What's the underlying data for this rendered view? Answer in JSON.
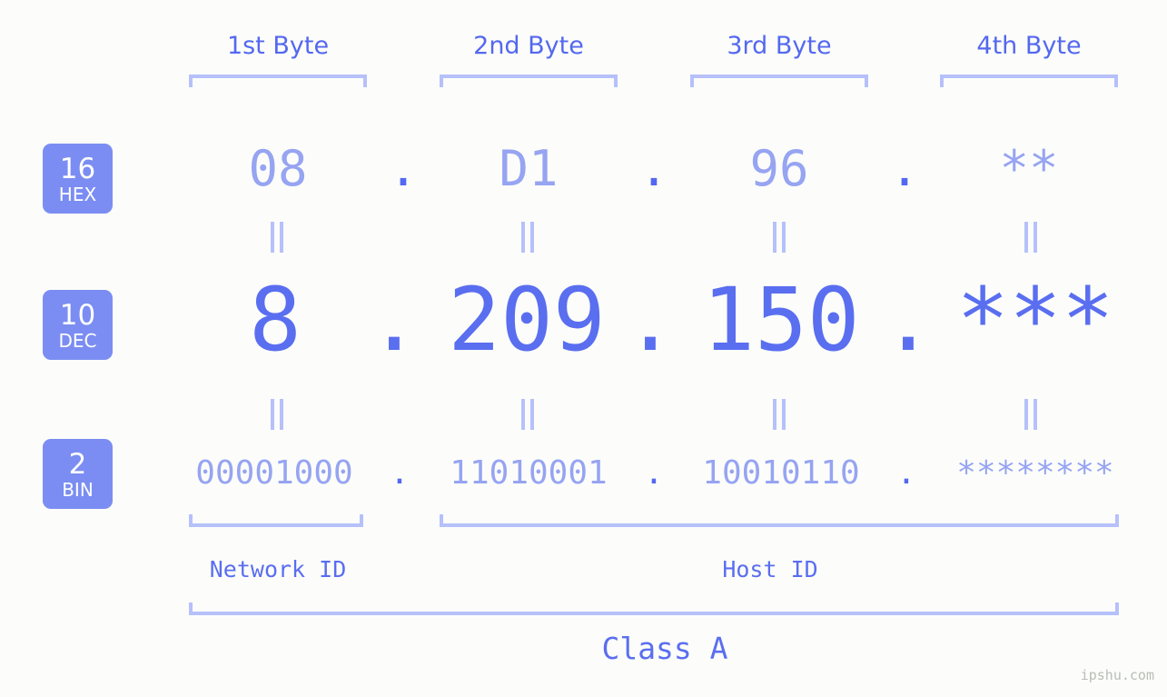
{
  "page": {
    "background_color": "#fcfdfa",
    "accent_color": "#5a6ef0",
    "muted_accent_color": "#96a4f2",
    "bracket_color": "#b6c0fb",
    "badge_color": "#7b8df2",
    "watermark": "ipshu.com"
  },
  "headers": [
    {
      "label": "1st Byte"
    },
    {
      "label": "2nd Byte"
    },
    {
      "label": "3rd Byte"
    },
    {
      "label": "4th Byte"
    }
  ],
  "radix_badges": [
    {
      "number": "16",
      "label": "HEX"
    },
    {
      "number": "10",
      "label": "DEC"
    },
    {
      "number": "2",
      "label": "BIN"
    }
  ],
  "rows": {
    "hex": {
      "radix": "16",
      "radix_label": "HEX",
      "bytes": [
        "08",
        "D1",
        "96",
        "**"
      ],
      "separator": "."
    },
    "dec": {
      "radix": "10",
      "radix_label": "DEC",
      "bytes": [
        "8",
        "209",
        "150",
        "***"
      ],
      "separator": "."
    },
    "bin": {
      "radix": "2",
      "radix_label": "BIN",
      "bytes": [
        "00001000",
        "11010001",
        "10010110",
        "********"
      ],
      "separator": "."
    }
  },
  "equivalence_symbol": "=",
  "sections": [
    {
      "label": "Network ID"
    },
    {
      "label": "Host ID"
    }
  ],
  "class": {
    "label": "Class A"
  }
}
